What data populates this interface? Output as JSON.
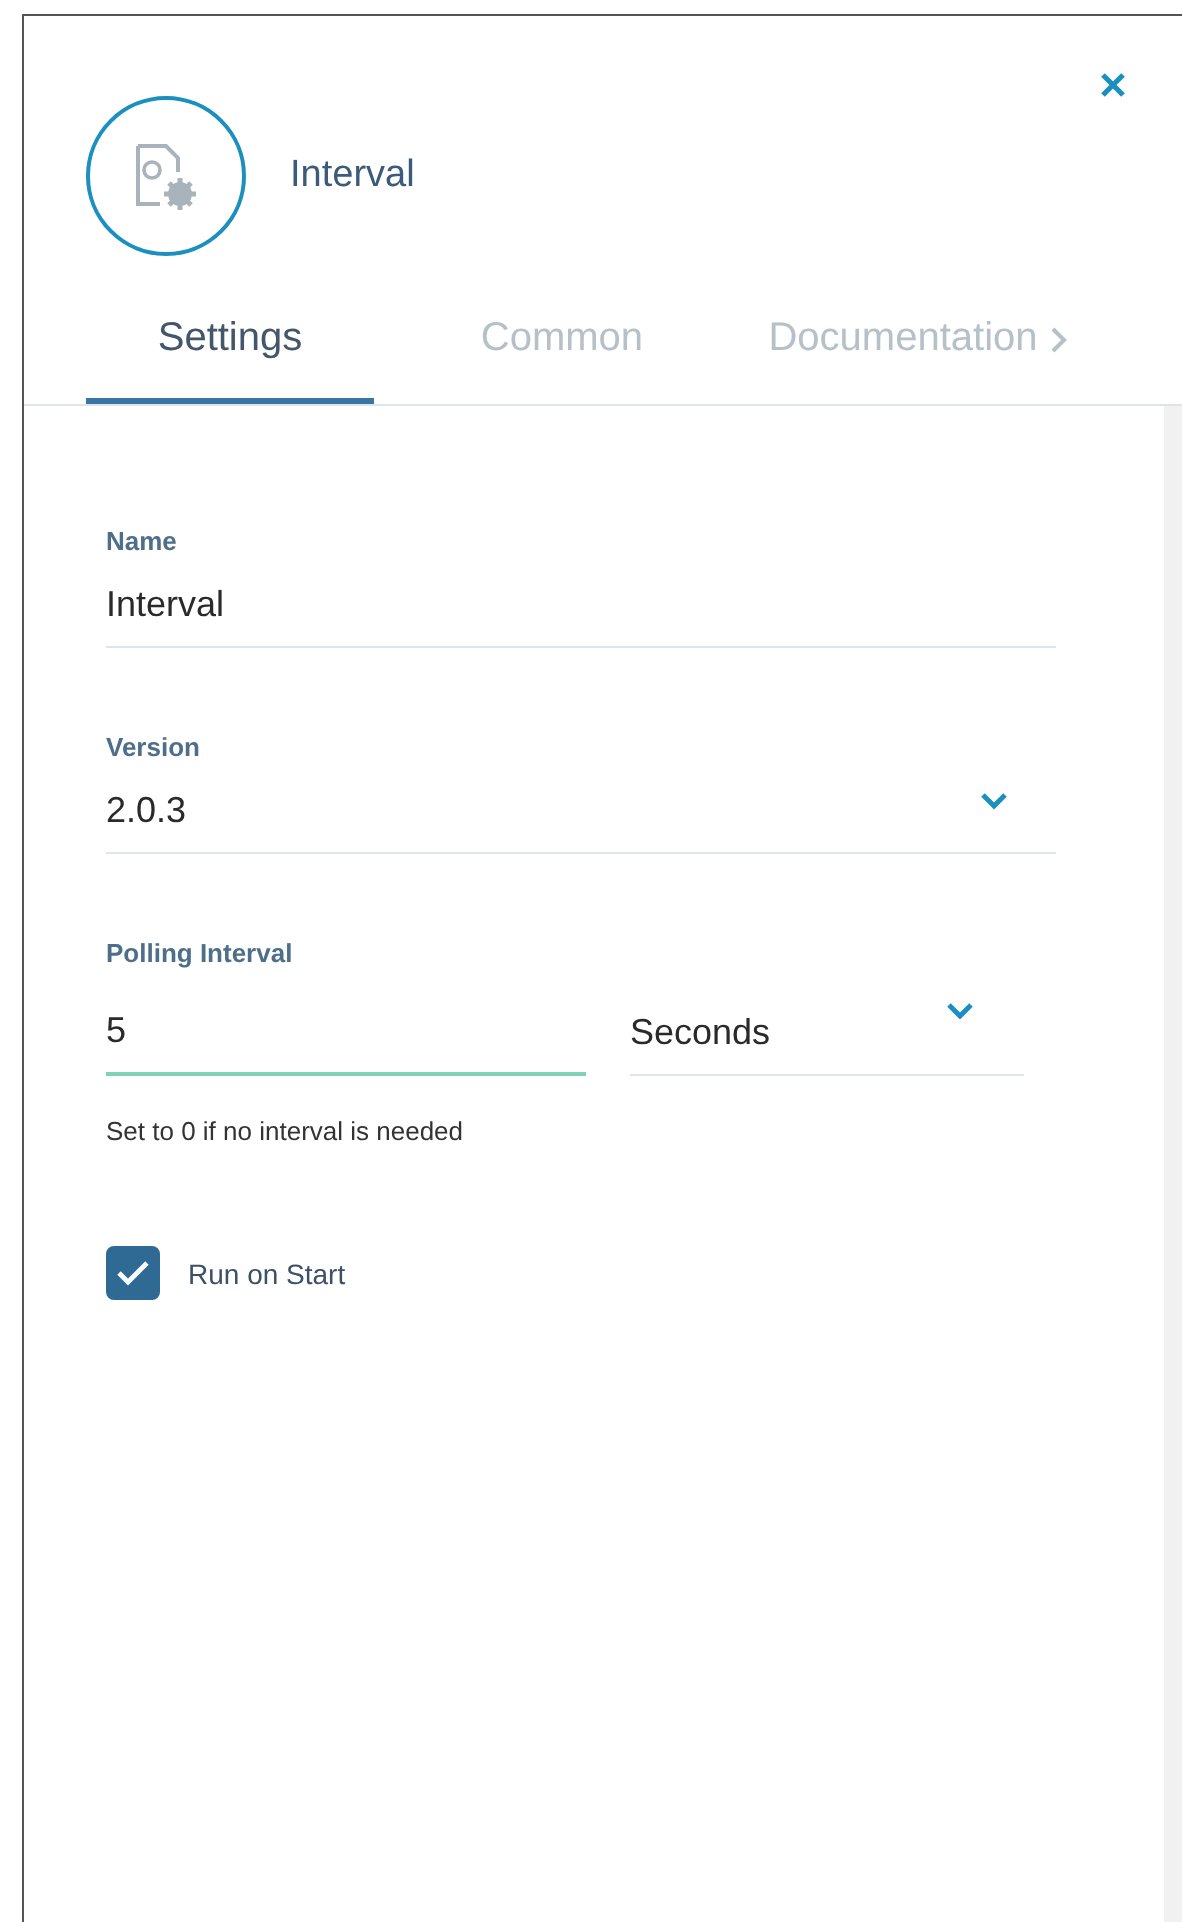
{
  "header": {
    "title": "Interval"
  },
  "tabs": [
    {
      "label": "Settings",
      "selected": true
    },
    {
      "label": "Common",
      "selected": false
    },
    {
      "label": "Documentation",
      "selected": false
    }
  ],
  "fields": [
    {
      "kind": "text",
      "label": "Name",
      "value": "Interval",
      "focused": false
    },
    {
      "kind": "select",
      "label": "Version",
      "value": "2.0.3",
      "focused": false
    }
  ],
  "polling": {
    "label": "Polling Interval",
    "value": "5",
    "focused": true,
    "unit": "Seconds",
    "hint": "Set to 0 if no interval is needed"
  },
  "run_on_start": {
    "label": "Run on Start",
    "checked": true
  }
}
